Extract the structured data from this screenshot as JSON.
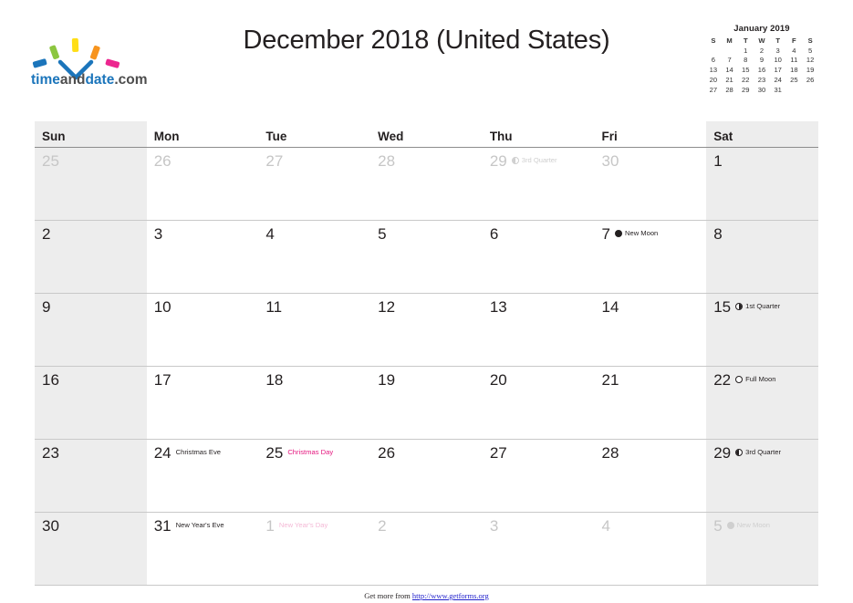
{
  "header": {
    "title": "December 2018 (United States)",
    "logo_text": "timeanddate.com",
    "logo_colors": {
      "blue": "#1b75bb",
      "green": "#8cc63f",
      "yellow": "#ffde17",
      "orange": "#f7941e",
      "pink": "#ec268f",
      "check": "#1b75bb"
    }
  },
  "mini_calendar": {
    "title": "January 2019",
    "weekdays": [
      "S",
      "M",
      "T",
      "W",
      "T",
      "F",
      "S"
    ],
    "weeks": [
      [
        "",
        "",
        "1",
        "2",
        "3",
        "4",
        "5"
      ],
      [
        "6",
        "7",
        "8",
        "9",
        "10",
        "11",
        "12"
      ],
      [
        "13",
        "14",
        "15",
        "16",
        "17",
        "18",
        "19"
      ],
      [
        "20",
        "21",
        "22",
        "23",
        "24",
        "25",
        "26"
      ],
      [
        "27",
        "28",
        "29",
        "30",
        "31",
        "",
        ""
      ]
    ]
  },
  "calendar": {
    "weekday_headers": [
      "Sun",
      "Mon",
      "Tue",
      "Wed",
      "Thu",
      "Fri",
      "Sat"
    ],
    "shaded_columns": [
      0,
      6
    ],
    "shade_color": "#ededed",
    "holiday_color": "#e5177f",
    "weeks": [
      [
        {
          "day": "25",
          "other": true
        },
        {
          "day": "26",
          "other": true
        },
        {
          "day": "27",
          "other": true
        },
        {
          "day": "28",
          "other": true
        },
        {
          "day": "29",
          "other": true,
          "moon": "third",
          "annotation": "3rd Quarter"
        },
        {
          "day": "30",
          "other": true
        },
        {
          "day": "1",
          "other": false
        }
      ],
      [
        {
          "day": "2",
          "other": false
        },
        {
          "day": "3",
          "other": false
        },
        {
          "day": "4",
          "other": false
        },
        {
          "day": "5",
          "other": false
        },
        {
          "day": "6",
          "other": false
        },
        {
          "day": "7",
          "other": false,
          "moon": "new",
          "annotation": "New Moon"
        },
        {
          "day": "8",
          "other": false
        }
      ],
      [
        {
          "day": "9",
          "other": false
        },
        {
          "day": "10",
          "other": false
        },
        {
          "day": "11",
          "other": false
        },
        {
          "day": "12",
          "other": false
        },
        {
          "day": "13",
          "other": false
        },
        {
          "day": "14",
          "other": false
        },
        {
          "day": "15",
          "other": false,
          "moon": "first",
          "annotation": "1st Quarter"
        }
      ],
      [
        {
          "day": "16",
          "other": false
        },
        {
          "day": "17",
          "other": false
        },
        {
          "day": "18",
          "other": false
        },
        {
          "day": "19",
          "other": false
        },
        {
          "day": "20",
          "other": false
        },
        {
          "day": "21",
          "other": false
        },
        {
          "day": "22",
          "other": false,
          "moon": "full",
          "annotation": "Full Moon"
        }
      ],
      [
        {
          "day": "23",
          "other": false
        },
        {
          "day": "24",
          "other": false,
          "annotation": "Christmas Eve"
        },
        {
          "day": "25",
          "other": false,
          "annotation": "Christmas Day",
          "holiday": true
        },
        {
          "day": "26",
          "other": false
        },
        {
          "day": "27",
          "other": false
        },
        {
          "day": "28",
          "other": false
        },
        {
          "day": "29",
          "other": false,
          "moon": "third",
          "annotation": "3rd Quarter"
        }
      ],
      [
        {
          "day": "30",
          "other": false
        },
        {
          "day": "31",
          "other": false,
          "annotation": "New Year's Eve"
        },
        {
          "day": "1",
          "other": true,
          "annotation": "New Year's Day",
          "holiday": true
        },
        {
          "day": "2",
          "other": true
        },
        {
          "day": "3",
          "other": true
        },
        {
          "day": "4",
          "other": true
        },
        {
          "day": "5",
          "other": true,
          "moon": "new",
          "annotation": "New Moon"
        }
      ]
    ]
  },
  "footer": {
    "prefix": "Get more from ",
    "url": "http://www.getforms.org"
  }
}
